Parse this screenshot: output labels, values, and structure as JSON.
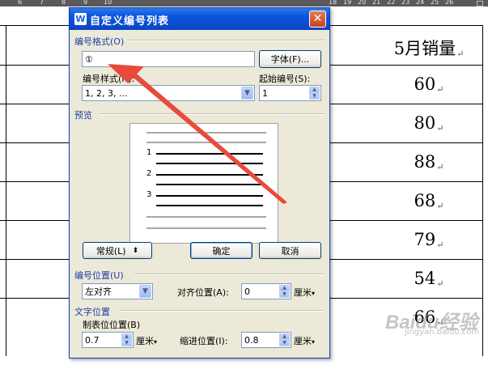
{
  "ruler": {
    "ticks": [
      "6",
      "7",
      "8",
      "9",
      "10",
      "18",
      "19",
      "20",
      "21",
      "22",
      "23",
      "24",
      "25",
      "26"
    ]
  },
  "document": {
    "header": "5月销量",
    "values": [
      "60",
      "80",
      "88",
      "68",
      "79",
      "54",
      "66"
    ],
    "paragraph_mark": "↵"
  },
  "watermark": {
    "text": "Baidu经验",
    "url": "jingyan.baidu.com"
  },
  "dialog": {
    "title": "自定义编号列表",
    "close_glyph": "✕",
    "number_format": {
      "group_label": "编号格式(O)",
      "value": "①",
      "font_button": "字体(F)..."
    },
    "number_style": {
      "label": "编号样式(N):",
      "value": "1, 2, 3, ...",
      "start_label": "起始编号(S):",
      "start_value": "1"
    },
    "preview": {
      "group_label": "预览",
      "numbers": [
        "1",
        "2",
        "3"
      ]
    },
    "buttons": {
      "normal": "常规(L)",
      "ok": "确定",
      "cancel": "取消"
    },
    "number_position": {
      "group_label": "编号位置(U)",
      "align_value": "左对齐",
      "align_pos_label": "对齐位置(A):",
      "align_pos_value": "0",
      "unit": "厘米"
    },
    "text_position": {
      "group_label": "文字位置",
      "tab_label": "制表位位置(B)",
      "tab_value": "0.7",
      "indent_label": "缩进位置(I):",
      "indent_value": "0.8",
      "unit": "厘米"
    }
  },
  "colors": {
    "titlebar": "#0a4cd0",
    "dialog_bg": "#ece9d8",
    "group_label": "#1f3ea8",
    "annotation_arrow": "#e84a3c"
  }
}
